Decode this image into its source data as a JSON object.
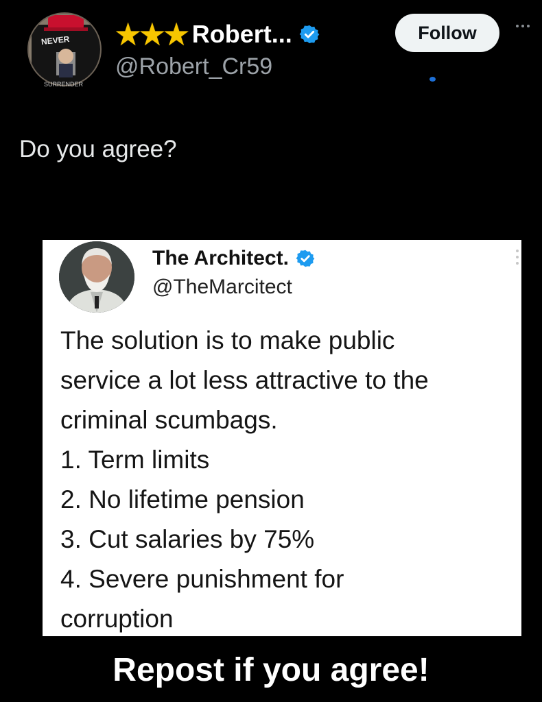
{
  "header": {
    "stars": "★★★",
    "display_name": "Robert...",
    "handle": "@Robert_Cr59",
    "follow_label": "Follow",
    "avatar_shirt_text": "NEVER",
    "avatar_shirt_subtext": "SURRENDER"
  },
  "tweet": {
    "text": "Do you agree?"
  },
  "embedded": {
    "display_name": "The Architect.",
    "handle": "@TheMarcitect",
    "lines": [
      "The solution is to make public",
      "service a lot less attractive to the",
      "criminal scumbags.",
      "1. Term limits",
      "2. No lifetime pension",
      "3. Cut salaries by 75%",
      "4. Severe punishment for",
      "corruption"
    ]
  },
  "footer": {
    "text": "Repost if you agree!"
  },
  "colors": {
    "background": "#000000",
    "verified": "#1d9bf0",
    "star": "#f7c600",
    "follow_bg": "#eff3f4",
    "handle": "#9da3a9"
  }
}
